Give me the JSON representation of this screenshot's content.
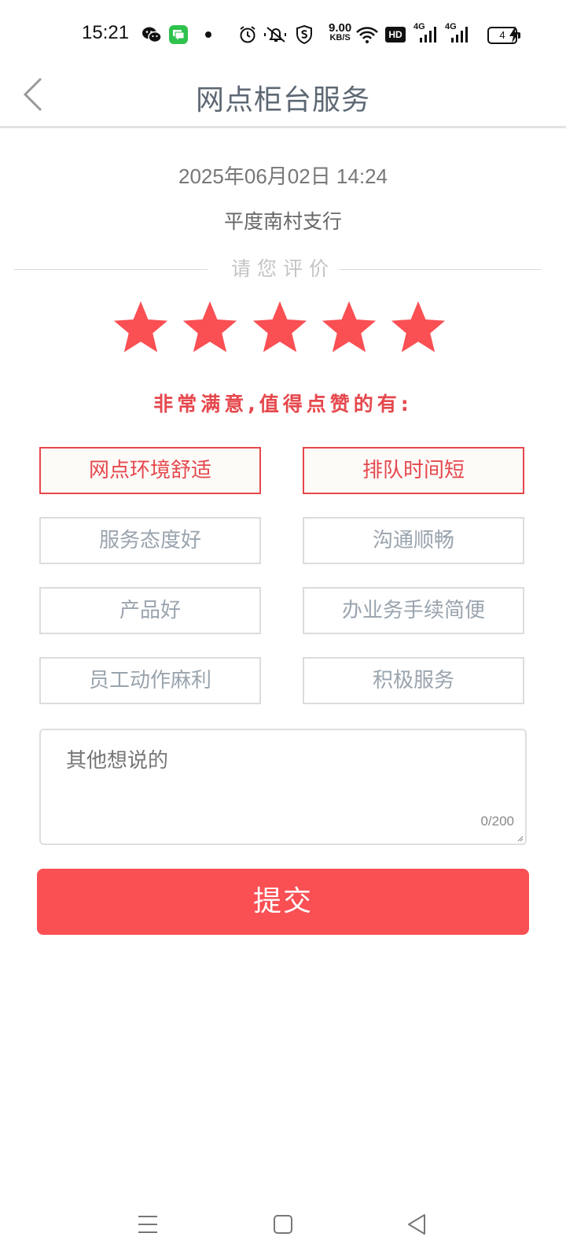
{
  "status_bar": {
    "time": "15:21",
    "icons": [
      "wechat-icon",
      "messages-icon",
      "dot-icon",
      "alarm-icon",
      "mute-icon",
      "shield-icon",
      "wifi-icon",
      "hd-icon",
      "signal-4g-icon",
      "signal-4g-icon",
      "battery-icon",
      "charging-icon"
    ],
    "net_speed_value": "9.00",
    "net_speed_unit": "KB/S",
    "hd_label": "HD",
    "net_type_1": "4G",
    "net_type_2": "4G",
    "battery_level": "4"
  },
  "header": {
    "title": "网点柜台服务",
    "back_icon": "chevron-left-icon"
  },
  "visit": {
    "datetime": "2025年06月02日 14:24",
    "branch": "平度南村支行"
  },
  "rating": {
    "prompt": "请您评价",
    "stars_filled": 5,
    "stars_total": 5,
    "description": "非常满意,值得点赞的有:",
    "star_color": "#fa4f53"
  },
  "tags": [
    {
      "label": "网点环境舒适",
      "selected": true
    },
    {
      "label": "排队时间短",
      "selected": true
    },
    {
      "label": "服务态度好",
      "selected": false
    },
    {
      "label": "沟通顺畅",
      "selected": false
    },
    {
      "label": "产品好",
      "selected": false
    },
    {
      "label": "办业务手续简便",
      "selected": false
    },
    {
      "label": "员工动作麻利",
      "selected": false
    },
    {
      "label": "积极服务",
      "selected": false
    }
  ],
  "comment": {
    "placeholder": "其他想说的",
    "char_count": "0/200"
  },
  "submit": {
    "label": "提交",
    "color": "#fa4f53"
  },
  "nav_bar": {
    "icons": [
      "menu-icon",
      "home-icon",
      "back-triangle-icon"
    ]
  },
  "colors": {
    "accent": "#e5484d",
    "title_gray": "#5d6873"
  }
}
